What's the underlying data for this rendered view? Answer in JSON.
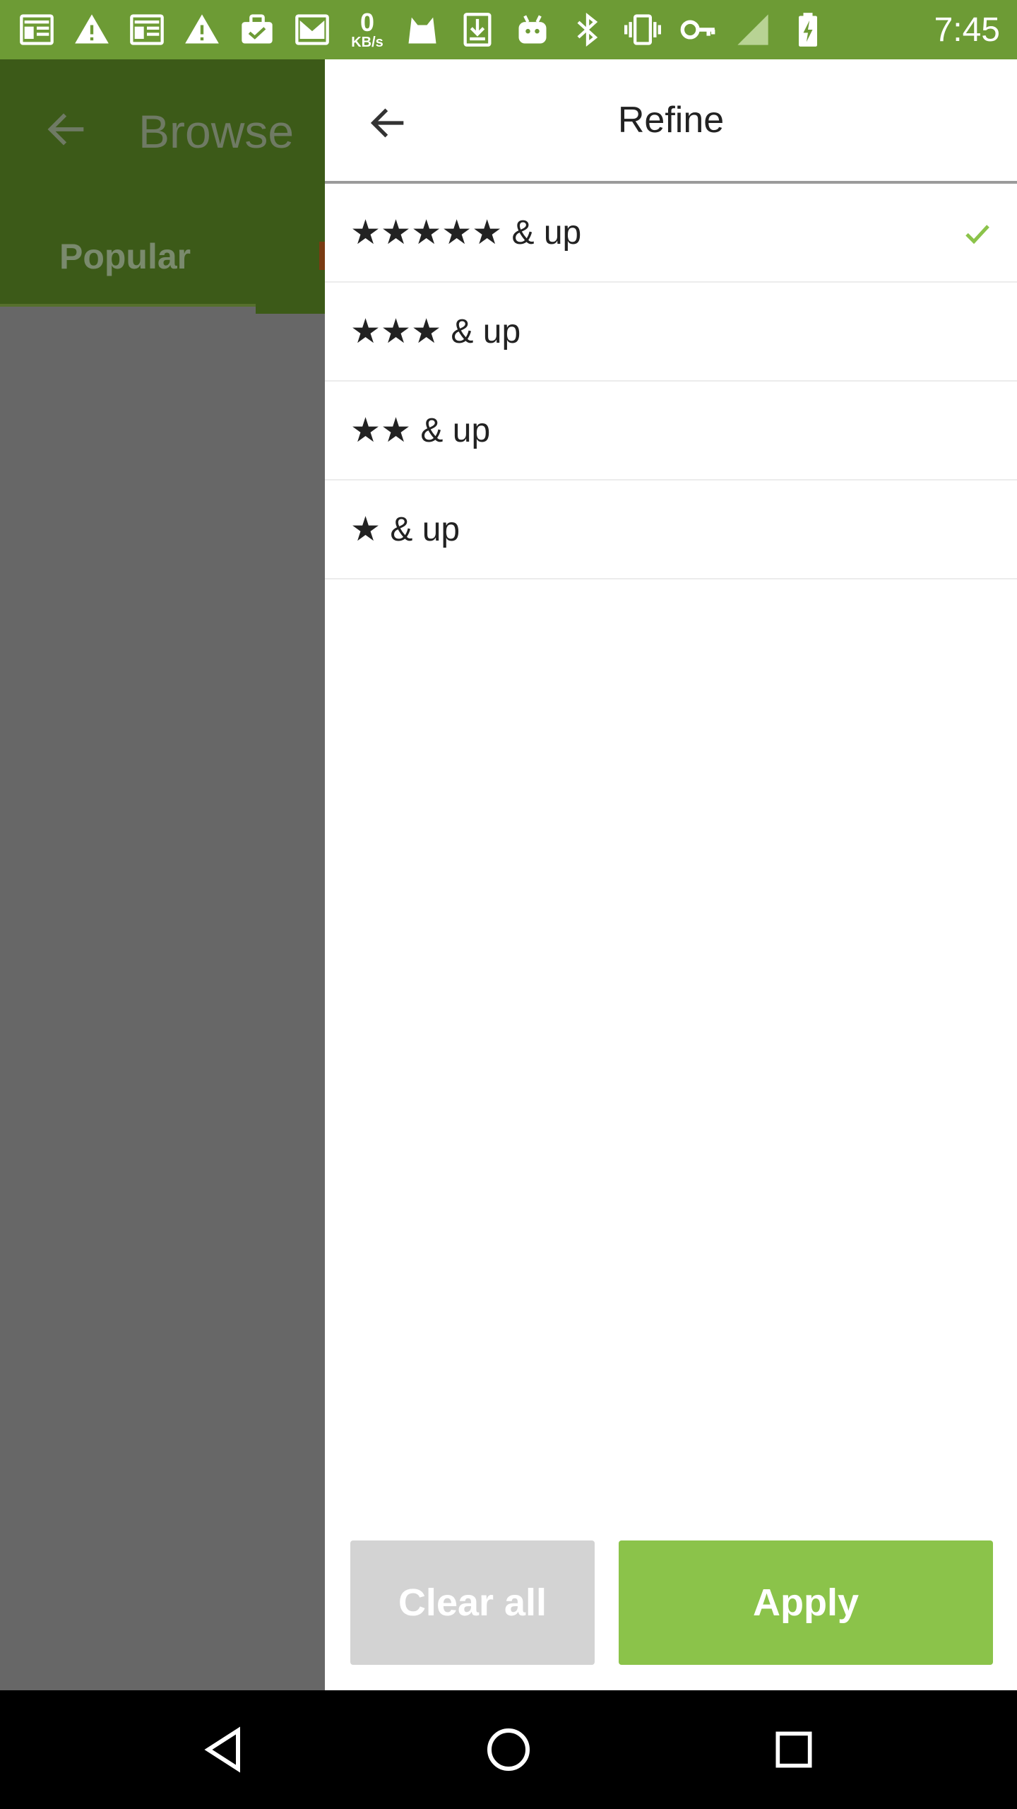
{
  "status_bar": {
    "time": "7:45",
    "net_speed_value": "0",
    "net_speed_unit": "KB/s",
    "icons": [
      "newspaper-icon",
      "warning-icon",
      "newspaper-icon",
      "warning-icon",
      "briefcase-check-icon",
      "mail-icon",
      "cat-icon",
      "download-icon",
      "android-icon",
      "bluetooth-icon",
      "vibrate-icon",
      "key-icon",
      "signal-icon",
      "battery-charging-icon"
    ],
    "background_color": "#6d9b35"
  },
  "background_screen": {
    "title": "Browse",
    "tab_label": "Popular"
  },
  "drawer": {
    "title": "Refine",
    "options": [
      {
        "label": "★★★★★ & up",
        "selected": true
      },
      {
        "label": "★★★ & up",
        "selected": false
      },
      {
        "label": "★★ & up",
        "selected": false
      },
      {
        "label": "★ & up",
        "selected": false
      }
    ],
    "clear_label": "Clear all",
    "apply_label": "Apply",
    "accent_color": "#8bc34a"
  },
  "nav_bar": {
    "icons": [
      "back-triangle-icon",
      "home-circle-icon",
      "recents-square-icon"
    ]
  }
}
